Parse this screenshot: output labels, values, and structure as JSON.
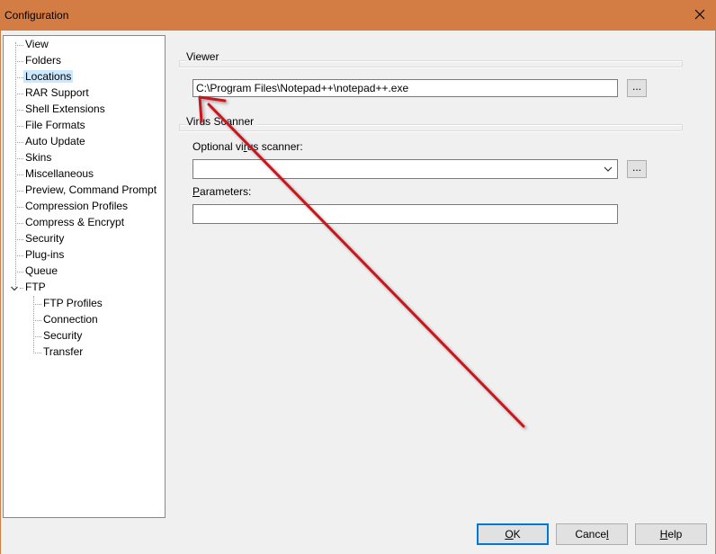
{
  "window": {
    "title": "Configuration",
    "close_icon": "close-icon"
  },
  "tree": {
    "items": [
      {
        "label": "View",
        "selected": false
      },
      {
        "label": "Folders",
        "selected": false
      },
      {
        "label": "Locations",
        "selected": true
      },
      {
        "label": "RAR Support",
        "selected": false
      },
      {
        "label": "Shell Extensions",
        "selected": false
      },
      {
        "label": "File Formats",
        "selected": false
      },
      {
        "label": "Auto Update",
        "selected": false
      },
      {
        "label": "Skins",
        "selected": false
      },
      {
        "label": "Miscellaneous",
        "selected": false
      },
      {
        "label": "Preview, Command Prompt",
        "selected": false
      },
      {
        "label": "Compression Profiles",
        "selected": false
      },
      {
        "label": "Compress & Encrypt",
        "selected": false
      },
      {
        "label": "Security",
        "selected": false
      },
      {
        "label": "Plug-ins",
        "selected": false
      },
      {
        "label": "Queue",
        "selected": false
      },
      {
        "label": "FTP",
        "selected": false,
        "expanded": true
      }
    ],
    "ftp_children": [
      {
        "label": "FTP Profiles"
      },
      {
        "label": "Connection"
      },
      {
        "label": "Security"
      },
      {
        "label": "Transfer"
      }
    ]
  },
  "viewer": {
    "group_label": "Viewer",
    "path_value": "C:\\Program Files\\Notepad++\\notepad++.exe",
    "browse_label": "..."
  },
  "virus": {
    "group_label": "Virus Scanner",
    "scanner_label_pre": "Optional vi",
    "scanner_label_ul": "r",
    "scanner_label_post": "us scanner:",
    "scanner_value": "",
    "browse_label": "...",
    "params_label_ul": "P",
    "params_label_post": "arameters:",
    "params_value": ""
  },
  "buttons": {
    "ok_ul": "O",
    "ok_post": "K",
    "cancel_pre": "Cance",
    "cancel_ul": "l",
    "help_ul": "H",
    "help_post": "elp"
  },
  "colors": {
    "titlebar": "#d37d45",
    "selection": "#cce8ff",
    "default_button_border": "#0078d7",
    "arrow": "#c8161d"
  }
}
